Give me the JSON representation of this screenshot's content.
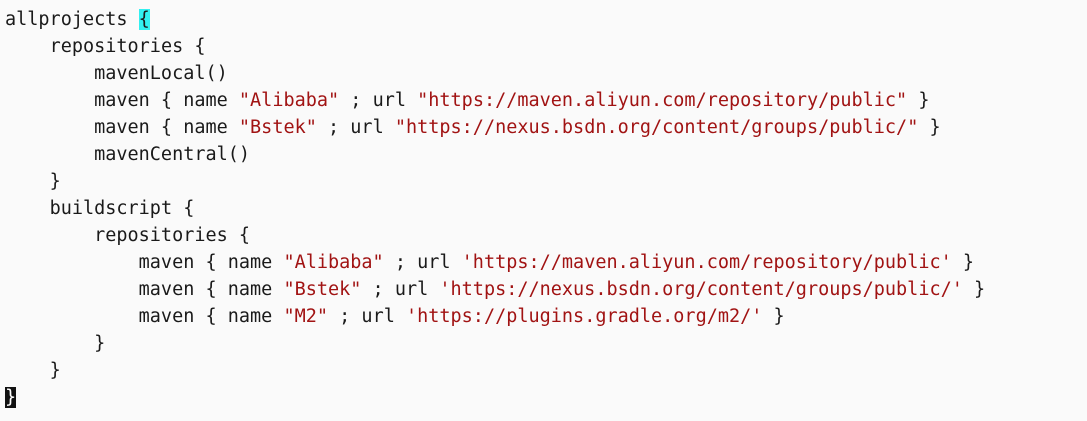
{
  "editor": {
    "lines": [
      {
        "indent": "",
        "tokens": [
          {
            "t": "allprojects ",
            "c": "kw"
          },
          {
            "t": "{",
            "c": "match"
          }
        ]
      },
      {
        "indent": "    ",
        "tokens": [
          {
            "t": "repositories {",
            "c": "kw"
          }
        ]
      },
      {
        "indent": "        ",
        "tokens": [
          {
            "t": "mavenLocal()",
            "c": "kw"
          }
        ]
      },
      {
        "indent": "        ",
        "tokens": [
          {
            "t": "maven { name ",
            "c": "kw"
          },
          {
            "t": "\"Alibaba\"",
            "c": "str"
          },
          {
            "t": " ; url ",
            "c": "kw"
          },
          {
            "t": "\"https://maven.aliyun.com/repository/public\"",
            "c": "str"
          },
          {
            "t": " }",
            "c": "kw"
          }
        ]
      },
      {
        "indent": "        ",
        "tokens": [
          {
            "t": "maven { name ",
            "c": "kw"
          },
          {
            "t": "\"Bstek\"",
            "c": "str"
          },
          {
            "t": " ; url ",
            "c": "kw"
          },
          {
            "t": "\"https://nexus.bsdn.org/content/groups/public/\"",
            "c": "str"
          },
          {
            "t": " }",
            "c": "kw"
          }
        ]
      },
      {
        "indent": "        ",
        "tokens": [
          {
            "t": "mavenCentral()",
            "c": "kw"
          }
        ]
      },
      {
        "indent": "    ",
        "tokens": [
          {
            "t": "}",
            "c": "kw"
          }
        ]
      },
      {
        "indent": "    ",
        "tokens": [
          {
            "t": "buildscript {",
            "c": "kw"
          }
        ]
      },
      {
        "indent": "        ",
        "tokens": [
          {
            "t": "repositories {",
            "c": "kw"
          }
        ]
      },
      {
        "indent": "            ",
        "tokens": [
          {
            "t": "maven { name ",
            "c": "kw"
          },
          {
            "t": "\"Alibaba\"",
            "c": "str"
          },
          {
            "t": " ; url ",
            "c": "kw"
          },
          {
            "t": "'https://maven.aliyun.com/repository/public'",
            "c": "str"
          },
          {
            "t": " }",
            "c": "kw"
          }
        ]
      },
      {
        "indent": "            ",
        "tokens": [
          {
            "t": "maven { name ",
            "c": "kw"
          },
          {
            "t": "\"Bstek\"",
            "c": "str"
          },
          {
            "t": " ; url ",
            "c": "kw"
          },
          {
            "t": "'https://nexus.bsdn.org/content/groups/public/'",
            "c": "str"
          },
          {
            "t": " }",
            "c": "kw"
          }
        ]
      },
      {
        "indent": "            ",
        "tokens": [
          {
            "t": "maven { name ",
            "c": "kw"
          },
          {
            "t": "\"M2\"",
            "c": "str"
          },
          {
            "t": " ; url ",
            "c": "kw"
          },
          {
            "t": "'https://plugins.gradle.org/m2/'",
            "c": "str"
          },
          {
            "t": " }",
            "c": "kw"
          }
        ]
      },
      {
        "indent": "        ",
        "tokens": [
          {
            "t": "}",
            "c": "kw"
          }
        ]
      },
      {
        "indent": "    ",
        "tokens": [
          {
            "t": "}",
            "c": "kw"
          }
        ]
      },
      {
        "indent": "",
        "tokens": [
          {
            "t": "}",
            "c": "cursor"
          }
        ]
      }
    ]
  },
  "colors": {
    "string": "#a11313",
    "text": "#1a1a1a",
    "bracket_match_highlight": "#33f0f0",
    "cursor": "#111111"
  }
}
